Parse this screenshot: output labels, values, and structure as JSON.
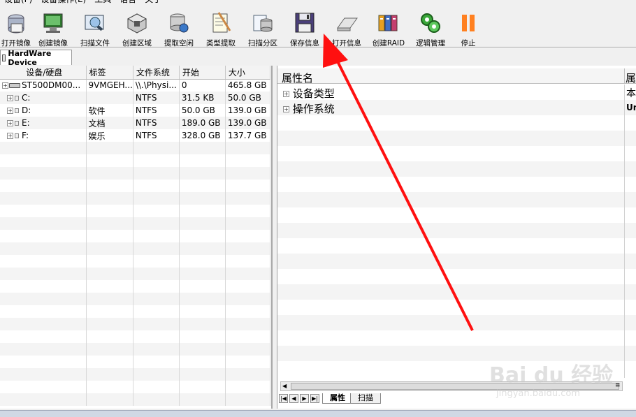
{
  "menu": [
    "设备(F)",
    "设备操作(E)",
    "工具",
    "语言",
    "关于"
  ],
  "toolbar": [
    {
      "label": "打开镜像",
      "icon": "disk-image-open-icon"
    },
    {
      "label": "创建镜像",
      "icon": "monitor-image-icon"
    },
    {
      "label": "扫描文件",
      "icon": "scan-file-icon"
    },
    {
      "label": "创建区域",
      "icon": "create-area-icon"
    },
    {
      "label": "提取空闲",
      "icon": "database-extract-icon"
    },
    {
      "label": "类型提取",
      "icon": "type-extract-icon"
    },
    {
      "label": "扫描分区",
      "icon": "scan-partition-icon"
    },
    {
      "label": "保存信息",
      "icon": "floppy-save-icon"
    },
    {
      "label": "打开信息",
      "icon": "open-info-icon"
    },
    {
      "label": "创建RAID",
      "icon": "raid-icon"
    },
    {
      "label": "逻辑管理",
      "icon": "logic-manage-icon"
    },
    {
      "label": "停止",
      "icon": "pause-stop-icon"
    }
  ],
  "device_tab": "HardWare Device",
  "left_table": {
    "columns": [
      "设备/硬盘",
      "标签",
      "文件系统",
      "开始",
      "大小"
    ],
    "rows": [
      {
        "device": "ST500DM00...",
        "label": "9VMGEH...",
        "fs": "\\\\.\\Physi...",
        "start": "0",
        "size": "465.8 GB"
      },
      {
        "device": "C:",
        "label": "",
        "fs": "NTFS",
        "start": "31.5 KB",
        "size": "50.0 GB"
      },
      {
        "device": "D:",
        "label": "软件",
        "fs": "NTFS",
        "start": "50.0 GB",
        "size": "139.0 GB"
      },
      {
        "device": "E:",
        "label": "文档",
        "fs": "NTFS",
        "start": "189.0 GB",
        "size": "139.0 GB"
      },
      {
        "device": "F:",
        "label": "娱乐",
        "fs": "NTFS",
        "start": "328.0 GB",
        "size": "137.7 GB"
      }
    ]
  },
  "right_panel": {
    "header_name": "属性名",
    "header_value": "属",
    "rows": [
      {
        "name": "设备类型",
        "value": "本"
      },
      {
        "name": "操作系统",
        "value": "Un"
      }
    ],
    "tabs": [
      "属性",
      "扫描"
    ]
  },
  "watermark": {
    "line1": "Bai du 经验",
    "line2": "jingyan.baidu.com"
  },
  "colors": {
    "arrow": "#ff1010",
    "stop_icon": "#ff8020",
    "accent_green": "#2a9a2a"
  }
}
